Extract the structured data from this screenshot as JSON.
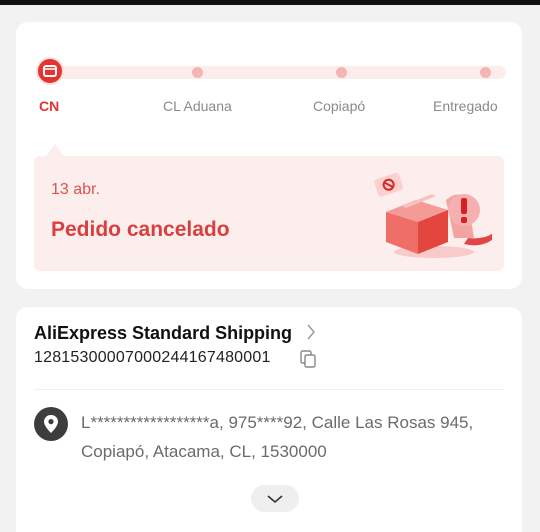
{
  "progress": {
    "steps": [
      {
        "label": "CN",
        "active": true,
        "icon": "china-origin-icon"
      },
      {
        "label": "CL Aduana",
        "active": false
      },
      {
        "label": "Copiapó",
        "active": false
      },
      {
        "label": "Entregado",
        "active": false
      }
    ]
  },
  "status": {
    "date": "13 abr.",
    "title": "Pedido cancelado",
    "icon": "cancelled-package-icon"
  },
  "shipping": {
    "carrier": "AliExpress Standard Shipping",
    "tracking_number": "12815300007000244167480001"
  },
  "address": {
    "line": "L******************a,  975****92,  Calle Las Rosas 945,  Copiapó,  Atacama,  CL,  1530000"
  },
  "colors": {
    "accent": "#e3342f",
    "track": "#fdecec",
    "cancel_bg": "#fdeeee"
  }
}
